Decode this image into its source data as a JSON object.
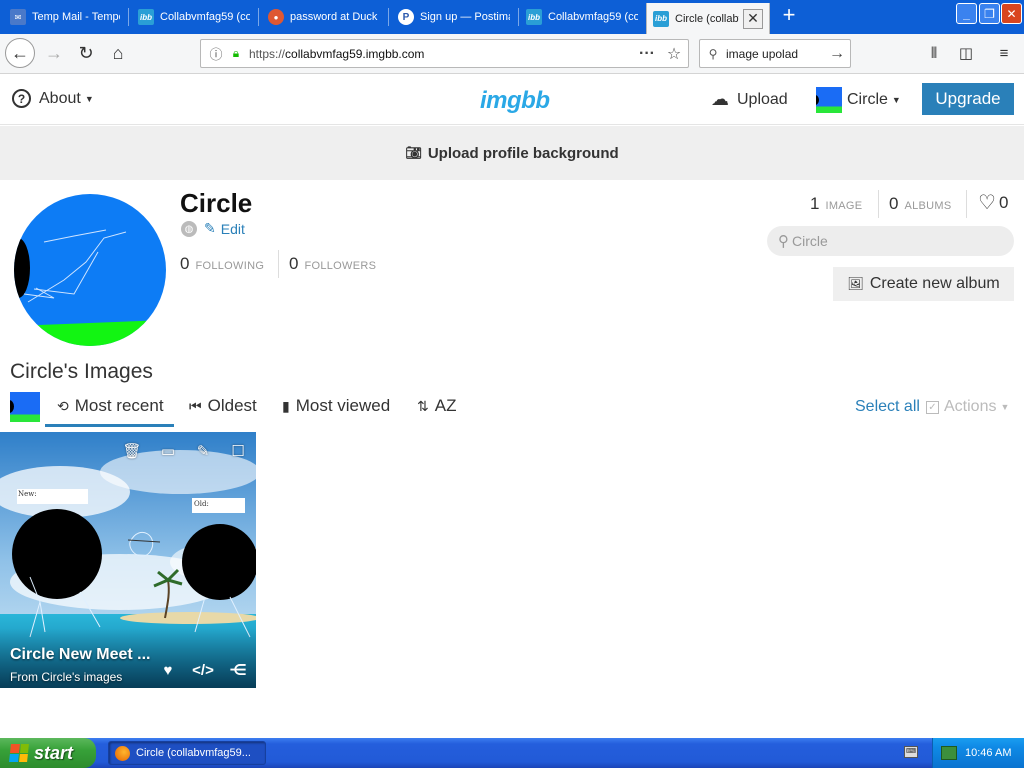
{
  "browser": {
    "tabs": [
      {
        "label": "Temp Mail - Tempo",
        "favicon": "mail-icon"
      },
      {
        "label": "Collabvmfag59 (co",
        "favicon": "ibb-icon"
      },
      {
        "label": "password at Duck",
        "favicon": "duckduckgo-icon"
      },
      {
        "label": "Sign up — Postima",
        "favicon": "postimage-icon"
      },
      {
        "label": "Collabvmfag59 (co",
        "favicon": "ibb-icon"
      },
      {
        "label": "Circle (collabv",
        "favicon": "ibb-icon",
        "active": true
      }
    ],
    "url_prefix": "https://",
    "url_host": "collabvmfag59.imgbb.com",
    "search_value": "image upolad"
  },
  "site": {
    "about_label": "About",
    "logo_text": "imgbb",
    "upload_label": "Upload",
    "user_menu_label": "Circle",
    "upgrade_label": "Upgrade",
    "banner_label": "Upload profile background",
    "brand_color": "#2a80b9"
  },
  "profile": {
    "name": "Circle",
    "edit_label": "Edit",
    "following_count": "0",
    "following_label": "FOLLOWING",
    "followers_count": "0",
    "followers_label": "FOLLOWERS",
    "images_count": "1",
    "images_label": "IMAGE",
    "albums_count": "0",
    "albums_label": "ALBUMS",
    "likes_count": "0",
    "search_placeholder": "Circle",
    "create_album_label": "Create new album"
  },
  "images_section": {
    "title": "Circle's Images",
    "sort_tabs": [
      {
        "label": "Most recent",
        "icon": "history-icon",
        "active": true
      },
      {
        "label": "Oldest",
        "icon": "fast-backward-icon"
      },
      {
        "label": "Most viewed",
        "icon": "bar-chart-icon"
      },
      {
        "label": "AZ",
        "icon": "sort-alpha-icon"
      }
    ],
    "select_all_label": "Select all",
    "actions_label": "Actions"
  },
  "tile": {
    "title": "Circle New Meet ...",
    "subtitle": "From Circle's images",
    "art_label_left": "New:",
    "art_label_right": "Old:"
  },
  "taskbar": {
    "start_label": "start",
    "task_label": "Circle (collabvmfag59...",
    "clock": "10:46 AM"
  }
}
